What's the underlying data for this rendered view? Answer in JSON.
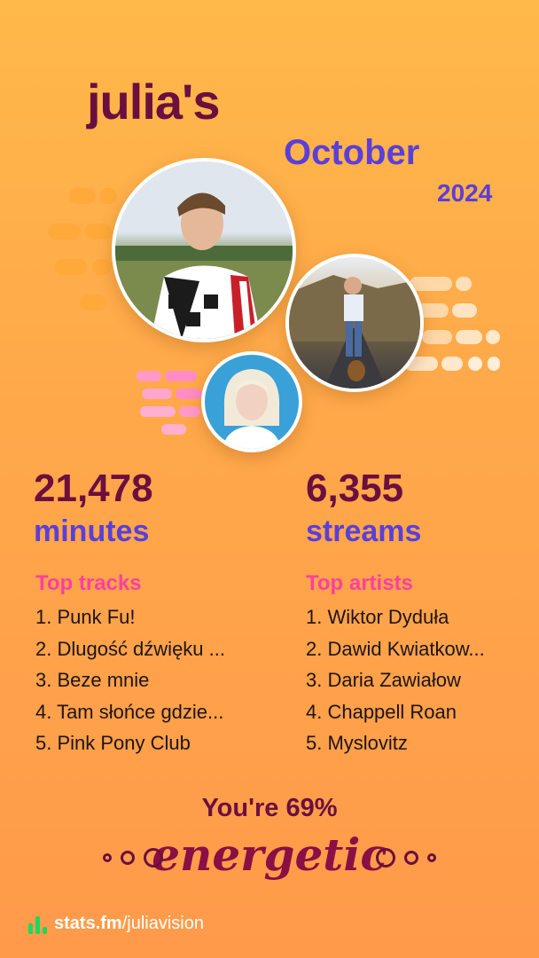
{
  "header": {
    "username": "julia's",
    "month": "October",
    "year": "2024"
  },
  "stats": {
    "minutes_value": "21,478",
    "minutes_label": "minutes",
    "streams_value": "6,355",
    "streams_label": "streams"
  },
  "top_tracks": {
    "heading": "Top tracks",
    "items": [
      "1. Punk Fu!",
      "2. Dlugość dźwięku ...",
      "3. Beze mnie",
      "4. Tam słońce gdzie...",
      "5. Pink Pony Club"
    ]
  },
  "top_artists": {
    "heading": "Top artists",
    "items": [
      "1. Wiktor Dyduła",
      "2. Dawid Kwiatkow...",
      "3. Daria Zawiałow",
      "4. Chappell Roan",
      "5. Myslovitz"
    ]
  },
  "mood": {
    "line": "You're 69%",
    "word": "energetic"
  },
  "footer": {
    "brand": "stats.fm",
    "path": "/juliavision",
    "icon": "stats-bars-icon"
  },
  "colors": {
    "background": "#ffa94a",
    "username": "#6b0f3f",
    "accent_purple": "#5a3fd8",
    "heading_pink": "#ff3fa0",
    "brand_green": "#1ed760"
  }
}
